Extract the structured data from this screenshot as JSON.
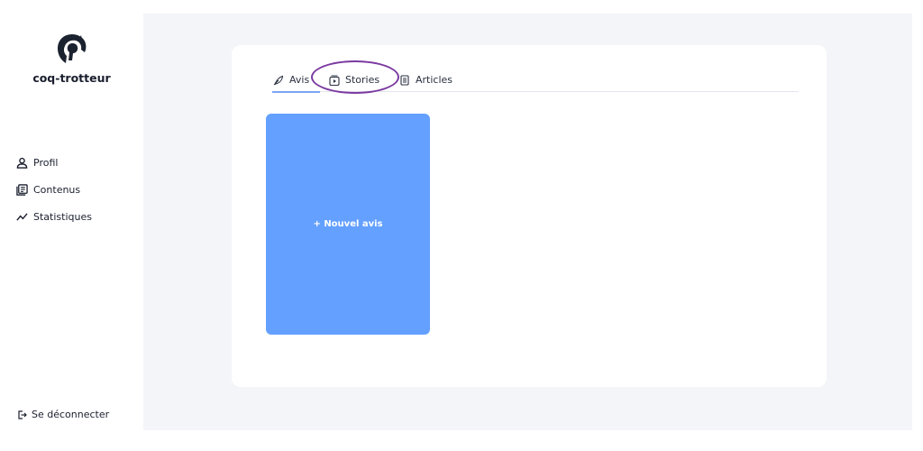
{
  "sidebar": {
    "brand": "coq-trotteur",
    "items": [
      {
        "label": "Profil",
        "icon": "user-icon"
      },
      {
        "label": "Contenus",
        "icon": "content-library-icon"
      },
      {
        "label": "Statistiques",
        "icon": "trend-line-icon"
      }
    ],
    "logout": {
      "label": "Se déconnecter",
      "icon": "logout-icon"
    }
  },
  "content": {
    "tabs": [
      {
        "label": "Avis",
        "icon": "review-feather-icon",
        "active": true
      },
      {
        "label": "Stories",
        "icon": "stories-play-icon",
        "active": false
      },
      {
        "label": "Articles",
        "icon": "article-document-icon",
        "active": false
      }
    ],
    "new_tile_label": "+ Nouvel avis"
  },
  "colors": {
    "background": "#f4f5f9",
    "card": "#ffffff",
    "tile": "#64a0ff",
    "active_tab_underline": "#7ea4f5",
    "annotation": "#7b3aa0"
  }
}
